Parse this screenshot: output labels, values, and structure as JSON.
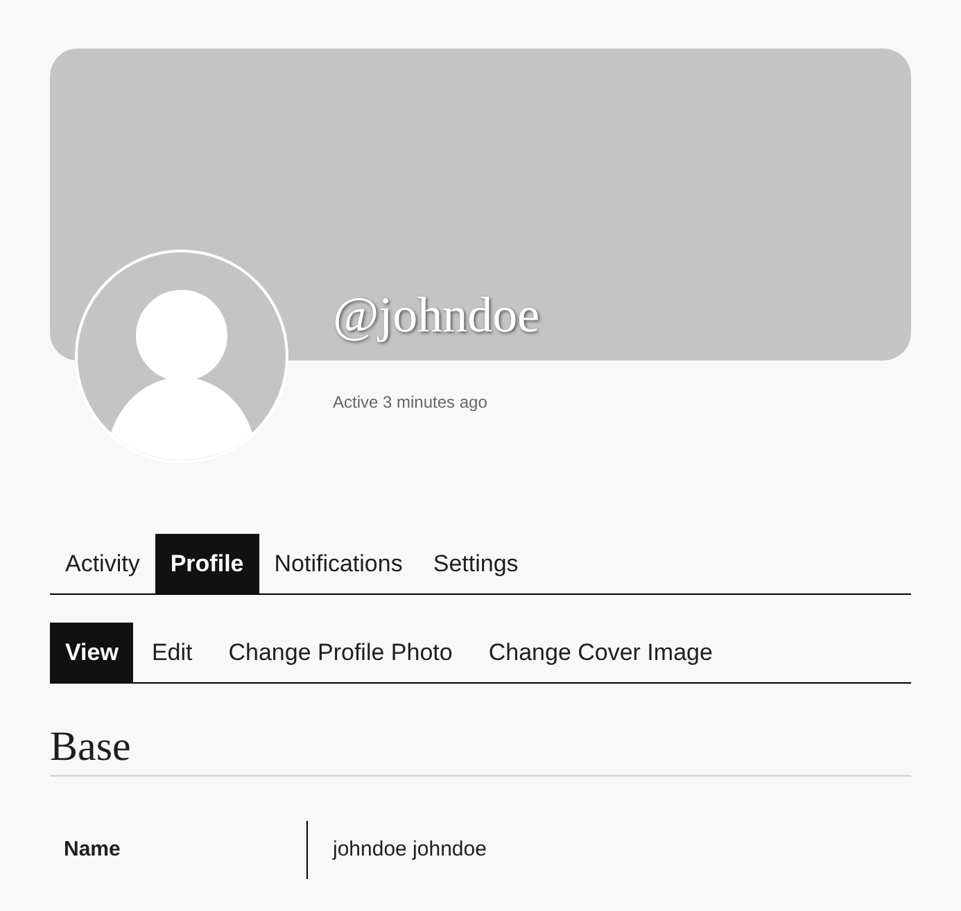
{
  "profile": {
    "username": "@johndoe",
    "last_active": "Active 3 minutes ago"
  },
  "tabs": [
    {
      "label": "Activity",
      "selected": false
    },
    {
      "label": "Profile",
      "selected": true
    },
    {
      "label": "Notifications",
      "selected": false
    },
    {
      "label": "Settings",
      "selected": false
    }
  ],
  "subtabs": [
    {
      "label": "View",
      "selected": true
    },
    {
      "label": "Edit",
      "selected": false
    },
    {
      "label": "Change Profile Photo",
      "selected": false
    },
    {
      "label": "Change Cover Image",
      "selected": false
    }
  ],
  "section": {
    "title": "Base",
    "fields": [
      {
        "label": "Name",
        "value": "johndoe johndoe"
      }
    ]
  }
}
